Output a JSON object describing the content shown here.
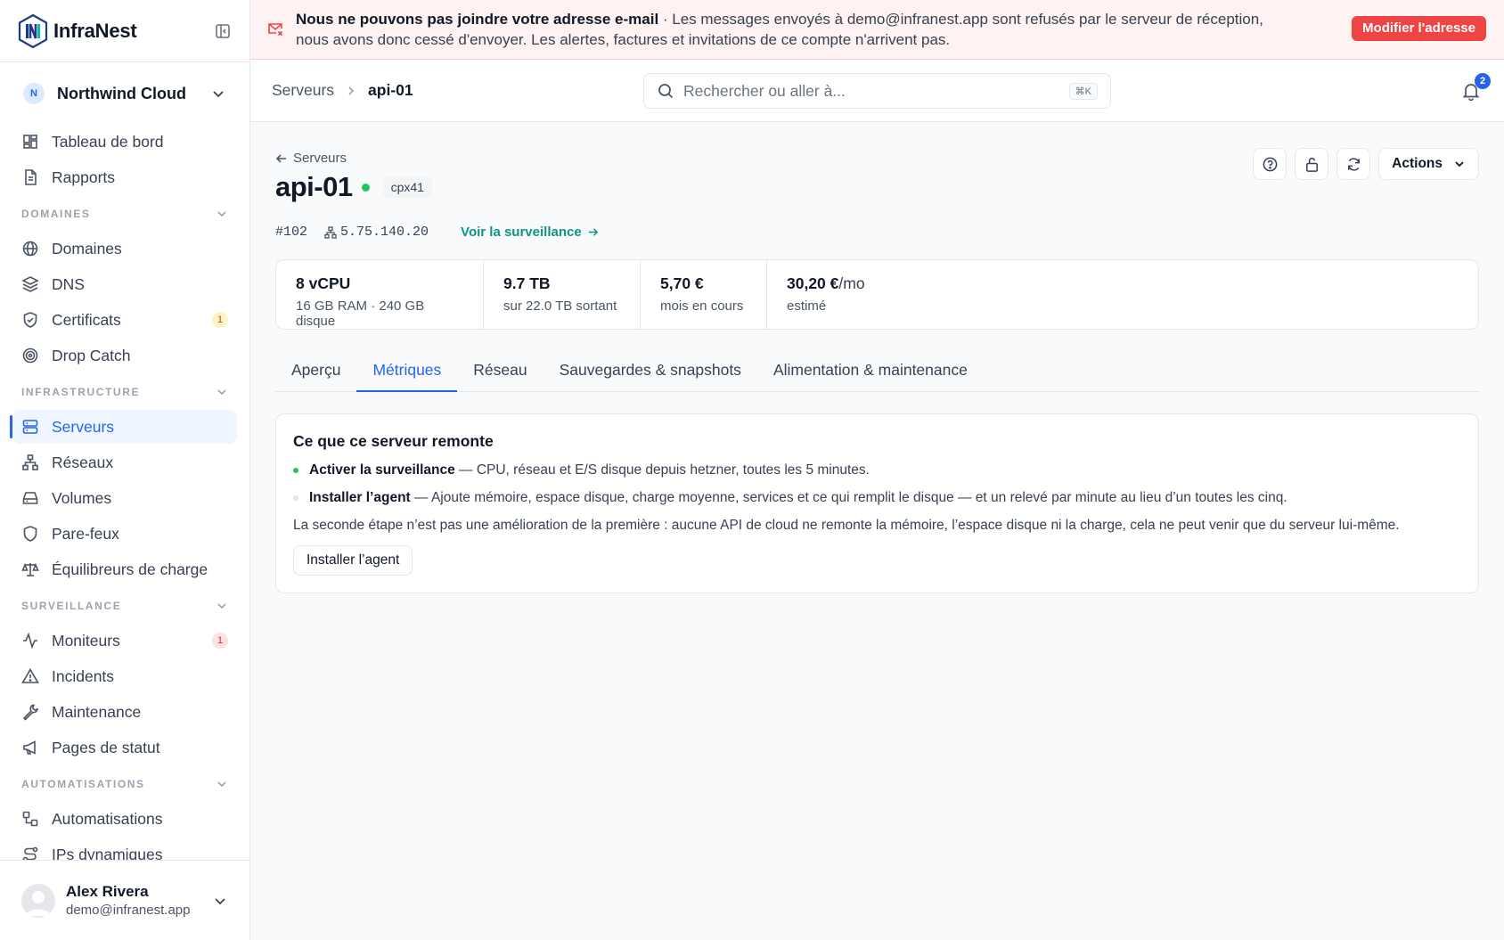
{
  "app": {
    "name": "InfraNest",
    "org": "Northwind Cloud",
    "org_initial": "N"
  },
  "sidebar": {
    "top": [
      {
        "label": "Tableau de bord"
      },
      {
        "label": "Rapports"
      }
    ],
    "sections": [
      {
        "title": "DOMAINES",
        "items": [
          {
            "label": "Domaines"
          },
          {
            "label": "DNS"
          },
          {
            "label": "Certificats",
            "badge": "1"
          },
          {
            "label": "Drop Catch"
          }
        ]
      },
      {
        "title": "INFRASTRUCTURE",
        "items": [
          {
            "label": "Serveurs"
          },
          {
            "label": "Réseaux"
          },
          {
            "label": "Volumes"
          },
          {
            "label": "Pare-feux"
          },
          {
            "label": "Équilibreurs de charge"
          }
        ]
      },
      {
        "title": "SURVEILLANCE",
        "items": [
          {
            "label": "Moniteurs",
            "badge": "1"
          },
          {
            "label": "Incidents"
          },
          {
            "label": "Maintenance"
          },
          {
            "label": "Pages de statut"
          }
        ]
      },
      {
        "title": "AUTOMATISATIONS",
        "items": [
          {
            "label": "Automatisations"
          },
          {
            "label": "IPs dynamiques"
          }
        ]
      }
    ]
  },
  "user": {
    "name": "Alex Rivera",
    "email": "demo@infranest.app"
  },
  "banner": {
    "title": "Nous ne pouvons pas joindre votre adresse e-mail",
    "text": " · Les messages envoyés à demo@infranest.app sont refusés par le serveur de réception, nous avons donc cessé d'envoyer. Les alertes, factures et invitations de ce compte n'arrivent pas.",
    "button": "Modifier l'adresse"
  },
  "topbar": {
    "crumb_parent": "Serveurs",
    "crumb_current": "api-01",
    "search_placeholder": "Rechercher ou aller à...",
    "search_kbd": "⌘K",
    "notifications": "2"
  },
  "server": {
    "back": "Serveurs",
    "name": "api-01",
    "type": "cpx41",
    "id": "#102",
    "ip": "5.75.140.20",
    "monitor_link": "Voir la surveillance",
    "actions": "Actions"
  },
  "stats": [
    {
      "value": "8 vCPU",
      "suffix": "",
      "sub": "16 GB RAM · 240 GB disque"
    },
    {
      "value": "9.7 TB",
      "suffix": "",
      "sub": "sur 22.0 TB sortant"
    },
    {
      "value": "5,70 €",
      "suffix": "",
      "sub": "mois en cours"
    },
    {
      "value": "30,20 €",
      "suffix": "/mo",
      "sub": "estimé"
    }
  ],
  "tabs": [
    "Aperçu",
    "Métriques",
    "Réseau",
    "Sauvegardes & snapshots",
    "Alimentation & maintenance"
  ],
  "card": {
    "title": "Ce que ce serveur remonte",
    "step1_bold": "Activer la surveillance",
    "step1_text": " — CPU, réseau et E/S disque depuis hetzner, toutes les 5 minutes.",
    "step2_bold": "Installer l’agent",
    "step2_text": " — Ajoute mémoire, espace disque, charge moyenne, services et ce qui remplit le disque — et un relevé par minute au lieu d’un toutes les cinq.",
    "note": "La seconde étape n’est pas une amélioration de la première : aucune API de cloud ne remonte la mémoire, l’espace disque ni la charge, cela ne peut venir que du serveur lui-même.",
    "button": "Installer l’agent"
  },
  "colors": {
    "accent": "#2563eb",
    "danger": "#ef4444",
    "success": "#22c55e",
    "link": "#0d9488"
  }
}
